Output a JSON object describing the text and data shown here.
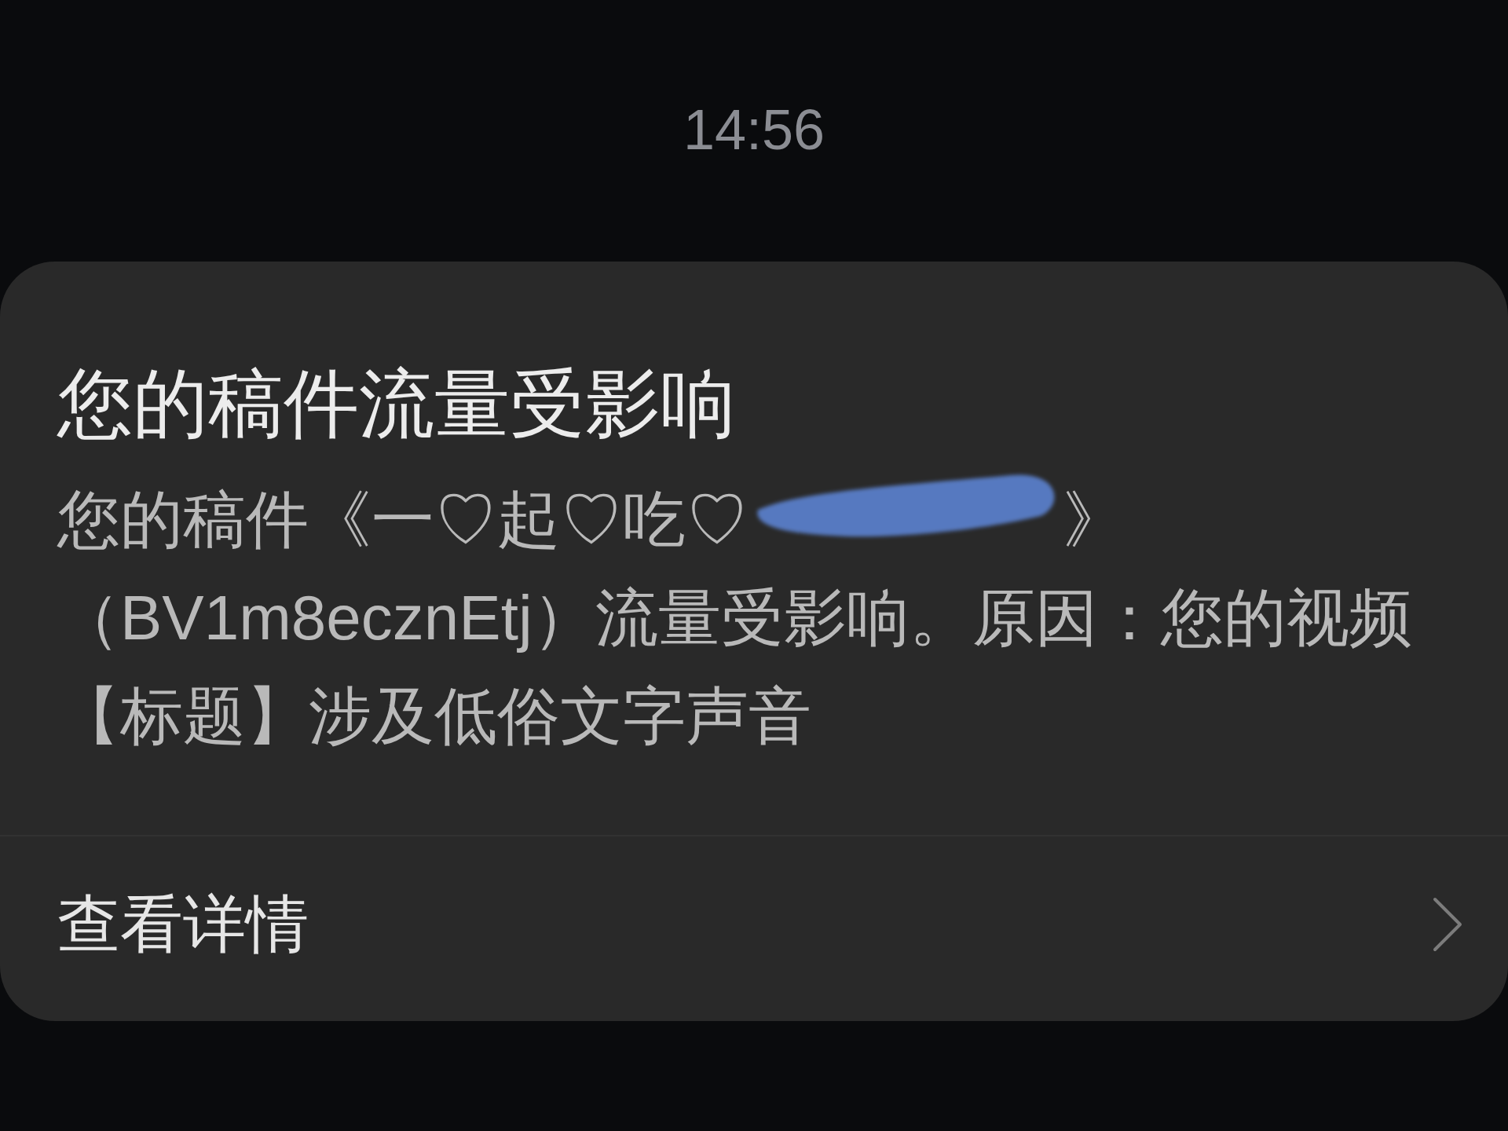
{
  "lock_screen": {
    "time": "14:56"
  },
  "notification": {
    "title": "您的稿件流量受影响",
    "message": {
      "before_redaction": "您的稿件《一♡起♡吃♡",
      "redacted": true,
      "after_redaction": "》（BV1m8ecznEtj）流量受影响。原因：您的视频【标题】涉及低俗文字声音"
    },
    "action": {
      "label": "查看详情"
    }
  }
}
